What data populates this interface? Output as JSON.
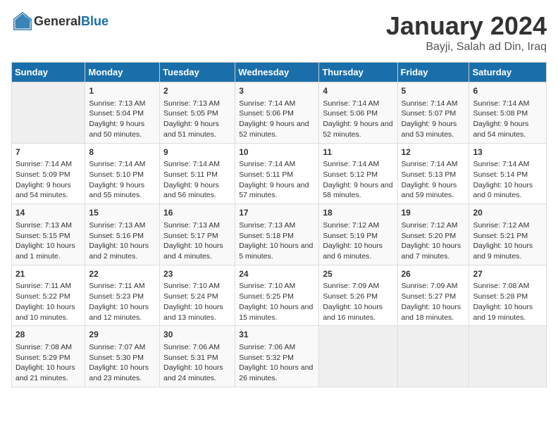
{
  "header": {
    "logo_general": "General",
    "logo_blue": "Blue",
    "month_title": "January 2024",
    "location": "Bayji, Salah ad Din, Iraq"
  },
  "weekdays": [
    "Sunday",
    "Monday",
    "Tuesday",
    "Wednesday",
    "Thursday",
    "Friday",
    "Saturday"
  ],
  "weeks": [
    [
      {
        "date": "",
        "sunrise": "",
        "sunset": "",
        "daylight": ""
      },
      {
        "date": "1",
        "sunrise": "Sunrise: 7:13 AM",
        "sunset": "Sunset: 5:04 PM",
        "daylight": "Daylight: 9 hours and 50 minutes."
      },
      {
        "date": "2",
        "sunrise": "Sunrise: 7:13 AM",
        "sunset": "Sunset: 5:05 PM",
        "daylight": "Daylight: 9 hours and 51 minutes."
      },
      {
        "date": "3",
        "sunrise": "Sunrise: 7:14 AM",
        "sunset": "Sunset: 5:06 PM",
        "daylight": "Daylight: 9 hours and 52 minutes."
      },
      {
        "date": "4",
        "sunrise": "Sunrise: 7:14 AM",
        "sunset": "Sunset: 5:06 PM",
        "daylight": "Daylight: 9 hours and 52 minutes."
      },
      {
        "date": "5",
        "sunrise": "Sunrise: 7:14 AM",
        "sunset": "Sunset: 5:07 PM",
        "daylight": "Daylight: 9 hours and 53 minutes."
      },
      {
        "date": "6",
        "sunrise": "Sunrise: 7:14 AM",
        "sunset": "Sunset: 5:08 PM",
        "daylight": "Daylight: 9 hours and 54 minutes."
      }
    ],
    [
      {
        "date": "7",
        "sunrise": "Sunrise: 7:14 AM",
        "sunset": "Sunset: 5:09 PM",
        "daylight": "Daylight: 9 hours and 54 minutes."
      },
      {
        "date": "8",
        "sunrise": "Sunrise: 7:14 AM",
        "sunset": "Sunset: 5:10 PM",
        "daylight": "Daylight: 9 hours and 55 minutes."
      },
      {
        "date": "9",
        "sunrise": "Sunrise: 7:14 AM",
        "sunset": "Sunset: 5:11 PM",
        "daylight": "Daylight: 9 hours and 56 minutes."
      },
      {
        "date": "10",
        "sunrise": "Sunrise: 7:14 AM",
        "sunset": "Sunset: 5:11 PM",
        "daylight": "Daylight: 9 hours and 57 minutes."
      },
      {
        "date": "11",
        "sunrise": "Sunrise: 7:14 AM",
        "sunset": "Sunset: 5:12 PM",
        "daylight": "Daylight: 9 hours and 58 minutes."
      },
      {
        "date": "12",
        "sunrise": "Sunrise: 7:14 AM",
        "sunset": "Sunset: 5:13 PM",
        "daylight": "Daylight: 9 hours and 59 minutes."
      },
      {
        "date": "13",
        "sunrise": "Sunrise: 7:14 AM",
        "sunset": "Sunset: 5:14 PM",
        "daylight": "Daylight: 10 hours and 0 minutes."
      }
    ],
    [
      {
        "date": "14",
        "sunrise": "Sunrise: 7:13 AM",
        "sunset": "Sunset: 5:15 PM",
        "daylight": "Daylight: 10 hours and 1 minute."
      },
      {
        "date": "15",
        "sunrise": "Sunrise: 7:13 AM",
        "sunset": "Sunset: 5:16 PM",
        "daylight": "Daylight: 10 hours and 2 minutes."
      },
      {
        "date": "16",
        "sunrise": "Sunrise: 7:13 AM",
        "sunset": "Sunset: 5:17 PM",
        "daylight": "Daylight: 10 hours and 4 minutes."
      },
      {
        "date": "17",
        "sunrise": "Sunrise: 7:13 AM",
        "sunset": "Sunset: 5:18 PM",
        "daylight": "Daylight: 10 hours and 5 minutes."
      },
      {
        "date": "18",
        "sunrise": "Sunrise: 7:12 AM",
        "sunset": "Sunset: 5:19 PM",
        "daylight": "Daylight: 10 hours and 6 minutes."
      },
      {
        "date": "19",
        "sunrise": "Sunrise: 7:12 AM",
        "sunset": "Sunset: 5:20 PM",
        "daylight": "Daylight: 10 hours and 7 minutes."
      },
      {
        "date": "20",
        "sunrise": "Sunrise: 7:12 AM",
        "sunset": "Sunset: 5:21 PM",
        "daylight": "Daylight: 10 hours and 9 minutes."
      }
    ],
    [
      {
        "date": "21",
        "sunrise": "Sunrise: 7:11 AM",
        "sunset": "Sunset: 5:22 PM",
        "daylight": "Daylight: 10 hours and 10 minutes."
      },
      {
        "date": "22",
        "sunrise": "Sunrise: 7:11 AM",
        "sunset": "Sunset: 5:23 PM",
        "daylight": "Daylight: 10 hours and 12 minutes."
      },
      {
        "date": "23",
        "sunrise": "Sunrise: 7:10 AM",
        "sunset": "Sunset: 5:24 PM",
        "daylight": "Daylight: 10 hours and 13 minutes."
      },
      {
        "date": "24",
        "sunrise": "Sunrise: 7:10 AM",
        "sunset": "Sunset: 5:25 PM",
        "daylight": "Daylight: 10 hours and 15 minutes."
      },
      {
        "date": "25",
        "sunrise": "Sunrise: 7:09 AM",
        "sunset": "Sunset: 5:26 PM",
        "daylight": "Daylight: 10 hours and 16 minutes."
      },
      {
        "date": "26",
        "sunrise": "Sunrise: 7:09 AM",
        "sunset": "Sunset: 5:27 PM",
        "daylight": "Daylight: 10 hours and 18 minutes."
      },
      {
        "date": "27",
        "sunrise": "Sunrise: 7:08 AM",
        "sunset": "Sunset: 5:28 PM",
        "daylight": "Daylight: 10 hours and 19 minutes."
      }
    ],
    [
      {
        "date": "28",
        "sunrise": "Sunrise: 7:08 AM",
        "sunset": "Sunset: 5:29 PM",
        "daylight": "Daylight: 10 hours and 21 minutes."
      },
      {
        "date": "29",
        "sunrise": "Sunrise: 7:07 AM",
        "sunset": "Sunset: 5:30 PM",
        "daylight": "Daylight: 10 hours and 23 minutes."
      },
      {
        "date": "30",
        "sunrise": "Sunrise: 7:06 AM",
        "sunset": "Sunset: 5:31 PM",
        "daylight": "Daylight: 10 hours and 24 minutes."
      },
      {
        "date": "31",
        "sunrise": "Sunrise: 7:06 AM",
        "sunset": "Sunset: 5:32 PM",
        "daylight": "Daylight: 10 hours and 26 minutes."
      },
      {
        "date": "",
        "sunrise": "",
        "sunset": "",
        "daylight": ""
      },
      {
        "date": "",
        "sunrise": "",
        "sunset": "",
        "daylight": ""
      },
      {
        "date": "",
        "sunrise": "",
        "sunset": "",
        "daylight": ""
      }
    ]
  ]
}
